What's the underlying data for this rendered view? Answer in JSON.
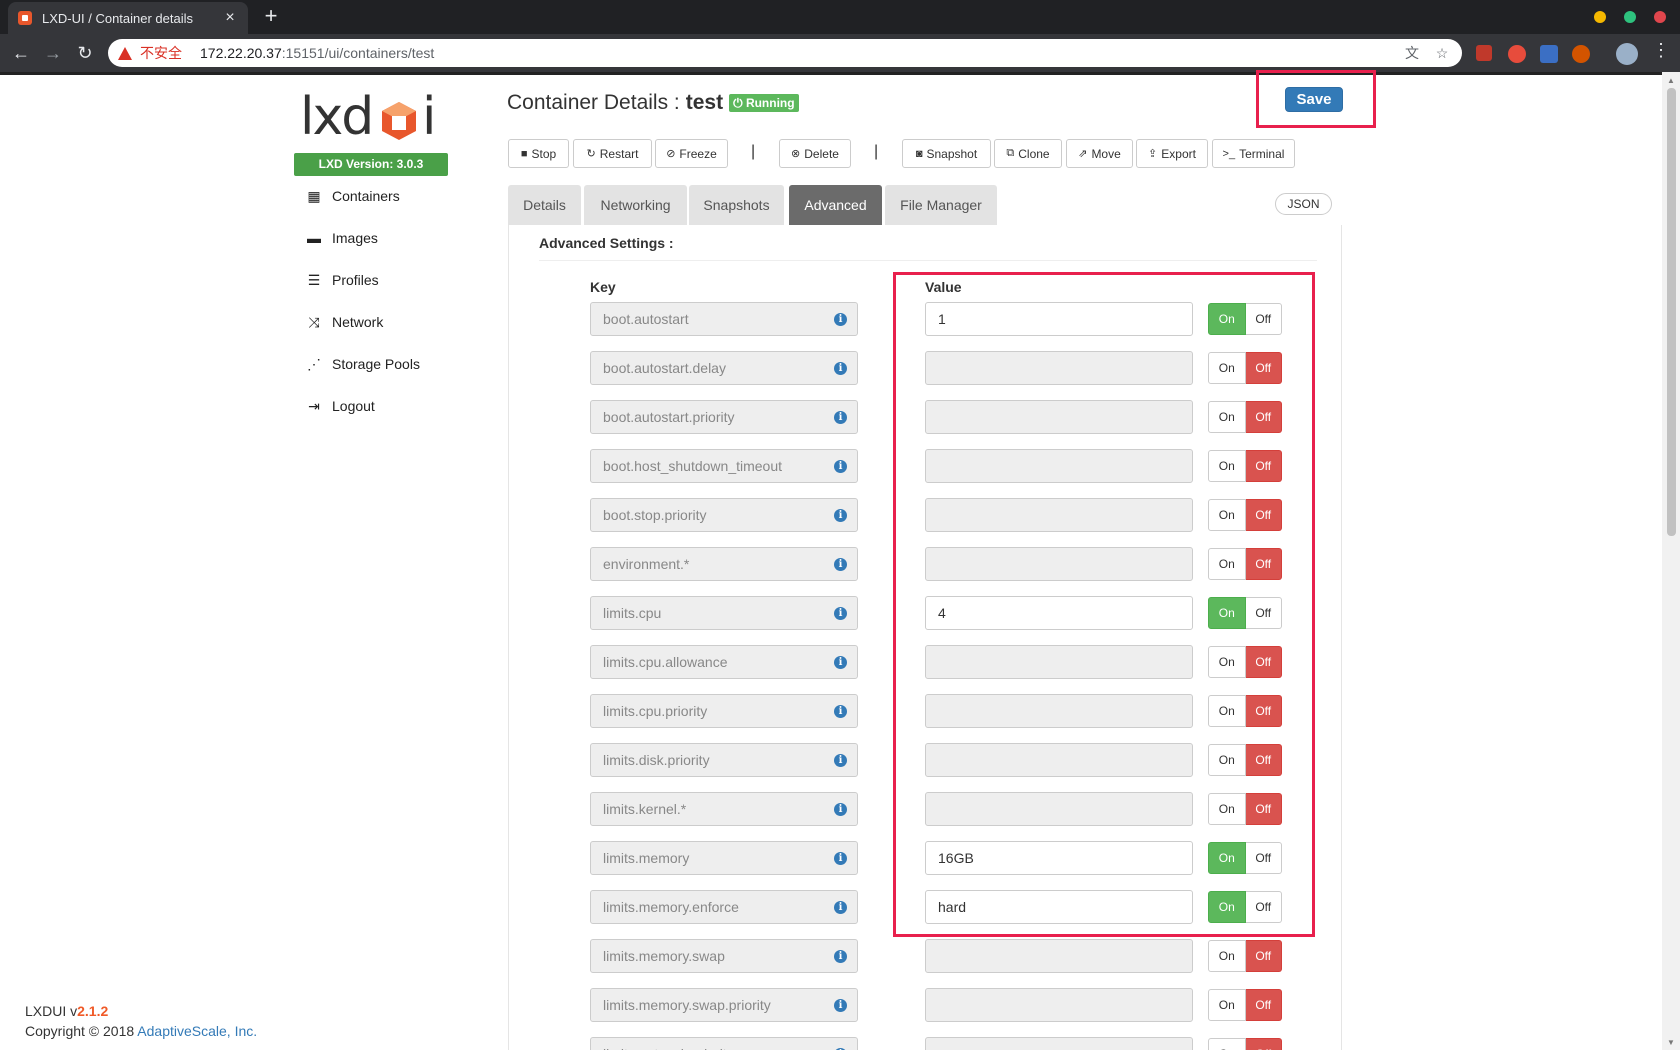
{
  "browser": {
    "tab_title": "LXD-UI / Container details",
    "tab_close": "×",
    "new_tab": "+",
    "insecure_label": "不安全",
    "url_host": "172.22.20.37",
    "url_path": ":15151/ui/containers/test"
  },
  "sidebar": {
    "logo": "lxd",
    "logo_suffix": "i",
    "version": "LXD Version: 3.0.3",
    "items": [
      {
        "label": "Containers",
        "icon": "grid-icon"
      },
      {
        "label": "Images",
        "icon": "image-icon"
      },
      {
        "label": "Profiles",
        "icon": "list-icon"
      },
      {
        "label": "Network",
        "icon": "shuffle-icon"
      },
      {
        "label": "Storage Pools",
        "icon": "sitemap-icon"
      },
      {
        "label": "Logout",
        "icon": "logout-icon"
      }
    ]
  },
  "footer": {
    "app": "LXDUI v",
    "version": "2.1.2",
    "copyright": "Copyright © 2018 ",
    "company": "AdaptiveScale, Inc."
  },
  "header": {
    "title_prefix": "Container Details :",
    "container_name": "test",
    "status": "Running",
    "save_label": "Save"
  },
  "actions": {
    "stop": "Stop",
    "restart": "Restart",
    "freeze": "Freeze",
    "separator": "|",
    "delete": "Delete",
    "snapshot": "Snapshot",
    "clone": "Clone",
    "move": "Move",
    "export": "Export",
    "terminal": "Terminal"
  },
  "tabs": {
    "details": "Details",
    "networking": "Networking",
    "snapshots": "Snapshots",
    "advanced": "Advanced",
    "file_manager": "File Manager",
    "json": "JSON",
    "active": "Advanced"
  },
  "advanced": {
    "title": "Advanced Settings :",
    "key_header": "Key",
    "value_header": "Value",
    "toggle_on": "On",
    "toggle_off": "Off",
    "info_glyph": "i",
    "rows": [
      {
        "key": "boot.autostart",
        "value": "1",
        "enabled": true
      },
      {
        "key": "boot.autostart.delay",
        "value": "",
        "enabled": false
      },
      {
        "key": "boot.autostart.priority",
        "value": "",
        "enabled": false
      },
      {
        "key": "boot.host_shutdown_timeout",
        "value": "",
        "enabled": false
      },
      {
        "key": "boot.stop.priority",
        "value": "",
        "enabled": false
      },
      {
        "key": "environment.*",
        "value": "",
        "enabled": false
      },
      {
        "key": "limits.cpu",
        "value": "4",
        "enabled": true
      },
      {
        "key": "limits.cpu.allowance",
        "value": "",
        "enabled": false
      },
      {
        "key": "limits.cpu.priority",
        "value": "",
        "enabled": false
      },
      {
        "key": "limits.disk.priority",
        "value": "",
        "enabled": false
      },
      {
        "key": "limits.kernel.*",
        "value": "",
        "enabled": false
      },
      {
        "key": "limits.memory",
        "value": "16GB",
        "enabled": true
      },
      {
        "key": "limits.memory.enforce",
        "value": "hard",
        "enabled": true
      },
      {
        "key": "limits.memory.swap",
        "value": "",
        "enabled": false
      },
      {
        "key": "limits.memory.swap.priority",
        "value": "",
        "enabled": false
      },
      {
        "key": "limits.network.priority",
        "value": "",
        "enabled": false
      }
    ]
  },
  "colors": {
    "on": "#5cb85c",
    "off": "#d9534f",
    "primary": "#337ab7",
    "highlight": "#e8204d"
  }
}
